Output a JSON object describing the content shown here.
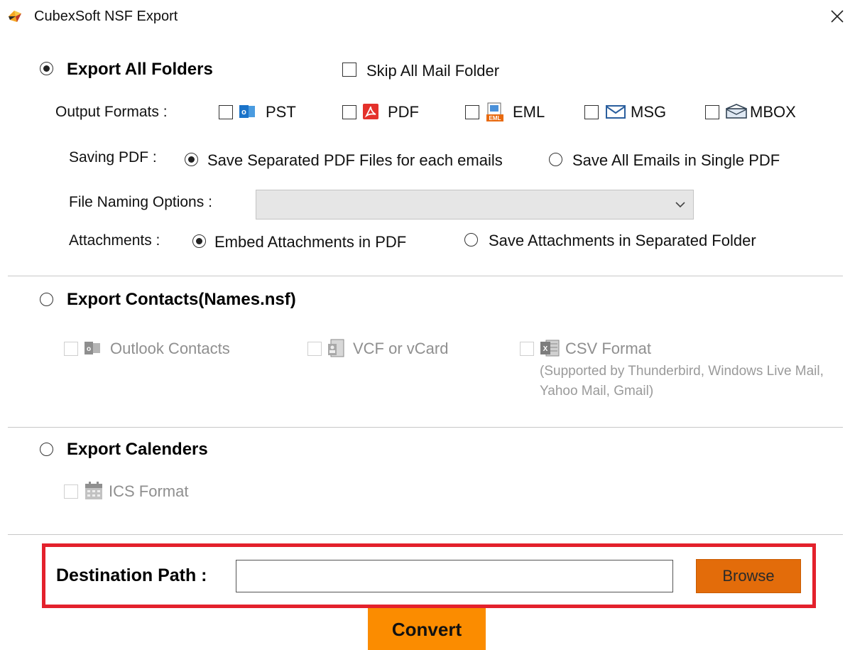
{
  "window": {
    "title": "CubexSoft NSF Export",
    "close_icon": "close-icon"
  },
  "export_all": {
    "label": "Export All Folders",
    "selected": true,
    "skip_mail_label": "Skip All Mail Folder",
    "output_formats_label": "Output Formats :",
    "formats": [
      {
        "label": "PST",
        "icon": "outlook-icon",
        "checked": false
      },
      {
        "label": "PDF",
        "icon": "pdf-icon",
        "checked": false
      },
      {
        "label": "EML",
        "icon": "eml-icon",
        "checked": false
      },
      {
        "label": "MSG",
        "icon": "envelope-icon",
        "checked": false
      },
      {
        "label": "MBOX",
        "icon": "mbox-icon",
        "checked": false
      }
    ],
    "saving_pdf": {
      "label": "Saving PDF :",
      "option_separate": "Save Separated PDF Files for each emails",
      "option_single": "Save All Emails in Single PDF",
      "selected": "separate"
    },
    "file_naming": {
      "label": "File Naming Options :",
      "value": ""
    },
    "attachments": {
      "label": "Attachments :",
      "option_embed": "Embed Attachments in PDF",
      "option_separate": "Save Attachments in Separated Folder",
      "selected": "embed"
    }
  },
  "export_contacts": {
    "label": "Export Contacts(Names.nsf)",
    "selected": false,
    "options": [
      {
        "label": "Outlook Contacts",
        "icon": "outlook-contacts-icon"
      },
      {
        "label": "VCF or vCard",
        "icon": "vcard-icon"
      },
      {
        "label": "CSV Format",
        "icon": "excel-icon"
      }
    ],
    "csv_note": "(Supported by Thunderbird, Windows Live Mail, Yahoo Mail, Gmail)"
  },
  "export_calendars": {
    "label": "Export Calenders",
    "selected": false,
    "option": {
      "label": "ICS Format",
      "icon": "calendar-icon"
    }
  },
  "destination": {
    "label": "Destination Path :",
    "value": "",
    "browse_label": "Browse"
  },
  "convert_label": "Convert",
  "colors": {
    "accent_orange": "#fb8c00",
    "browse_orange": "#e36c0a",
    "highlight_red": "#e3212c",
    "pdf_red": "#e4312b",
    "outlook_blue": "#1a73c9"
  }
}
